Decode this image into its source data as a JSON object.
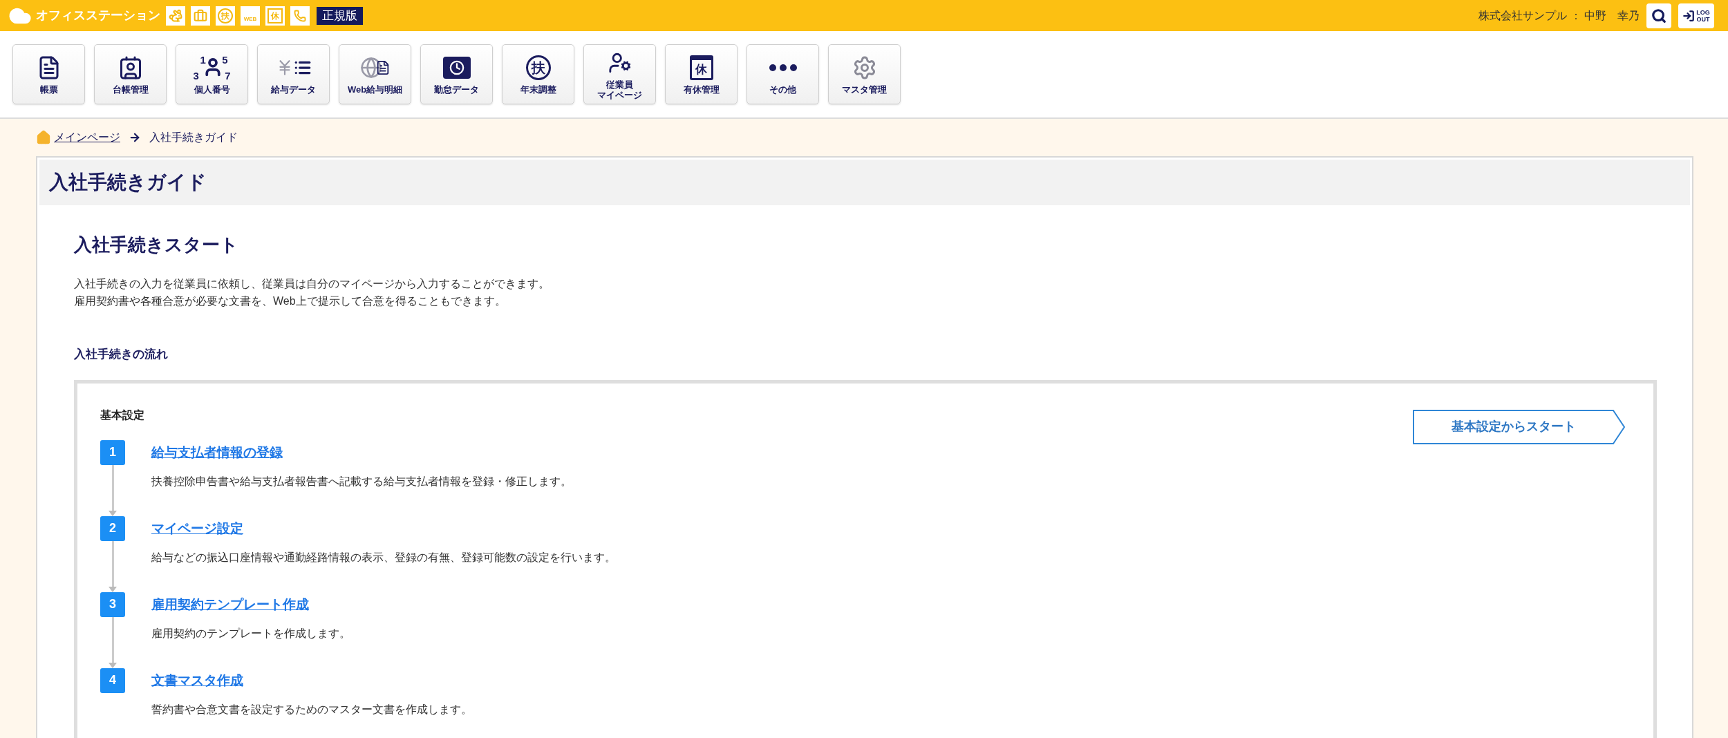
{
  "header": {
    "app_name": "オフィスステーション",
    "shortcut_glyphs": [
      "扶",
      "WEB",
      "休"
    ],
    "edition": "正規版",
    "user": "株式会社サンプル ： 中野　幸乃",
    "logout": [
      "LOG",
      "OUT"
    ]
  },
  "menu": [
    {
      "lines": [
        "帳票"
      ]
    },
    {
      "lines": [
        "台帳管理"
      ]
    },
    {
      "lines": [
        "個人番号"
      ],
      "digits": [
        "1",
        "5",
        "3",
        "7"
      ]
    },
    {
      "lines": [
        "給与データ"
      ]
    },
    {
      "lines": [
        "Web給与明細"
      ]
    },
    {
      "lines": [
        "勤怠データ"
      ]
    },
    {
      "lines": [
        "年末調整"
      ],
      "glyph": "扶"
    },
    {
      "lines": [
        "従業員",
        "マイページ"
      ]
    },
    {
      "lines": [
        "有休管理"
      ],
      "glyph": "休"
    },
    {
      "lines": [
        "その他"
      ]
    },
    {
      "lines": [
        "マスタ管理"
      ]
    }
  ],
  "breadcrumb": {
    "home": "メインページ",
    "current": "入社手続きガイド"
  },
  "page_title": "入社手続きガイド",
  "section": {
    "title": "入社手続きスタート",
    "description": [
      "入社手続きの入力を従業員に依頼し、従業員は自分のマイページから入力することができます。",
      "雇用契約書や各種合意が必要な文書を、Web上で提示して合意を得ることもできます。"
    ],
    "flow_heading": "入社手続きの流れ",
    "flow": {
      "group_title": "基本設定",
      "start_button": "基本設定からスタート",
      "steps": [
        {
          "number": "1",
          "title": "給与支払者情報の登録",
          "description": "扶養控除申告書や給与支払者報告書へ記載する給与支払者情報を登録・修正します。"
        },
        {
          "number": "2",
          "title": "マイページ設定",
          "description": "給与などの振込口座情報や通勤経路情報の表示、登録の有無、登録可能数の設定を行います。"
        },
        {
          "number": "3",
          "title": "雇用契約テンプレート作成",
          "description": "雇用契約のテンプレートを作成します。"
        },
        {
          "number": "4",
          "title": "文書マスタ作成",
          "description": "誓約書や合意文書を設定するためのマスター文書を作成します。"
        }
      ]
    }
  }
}
